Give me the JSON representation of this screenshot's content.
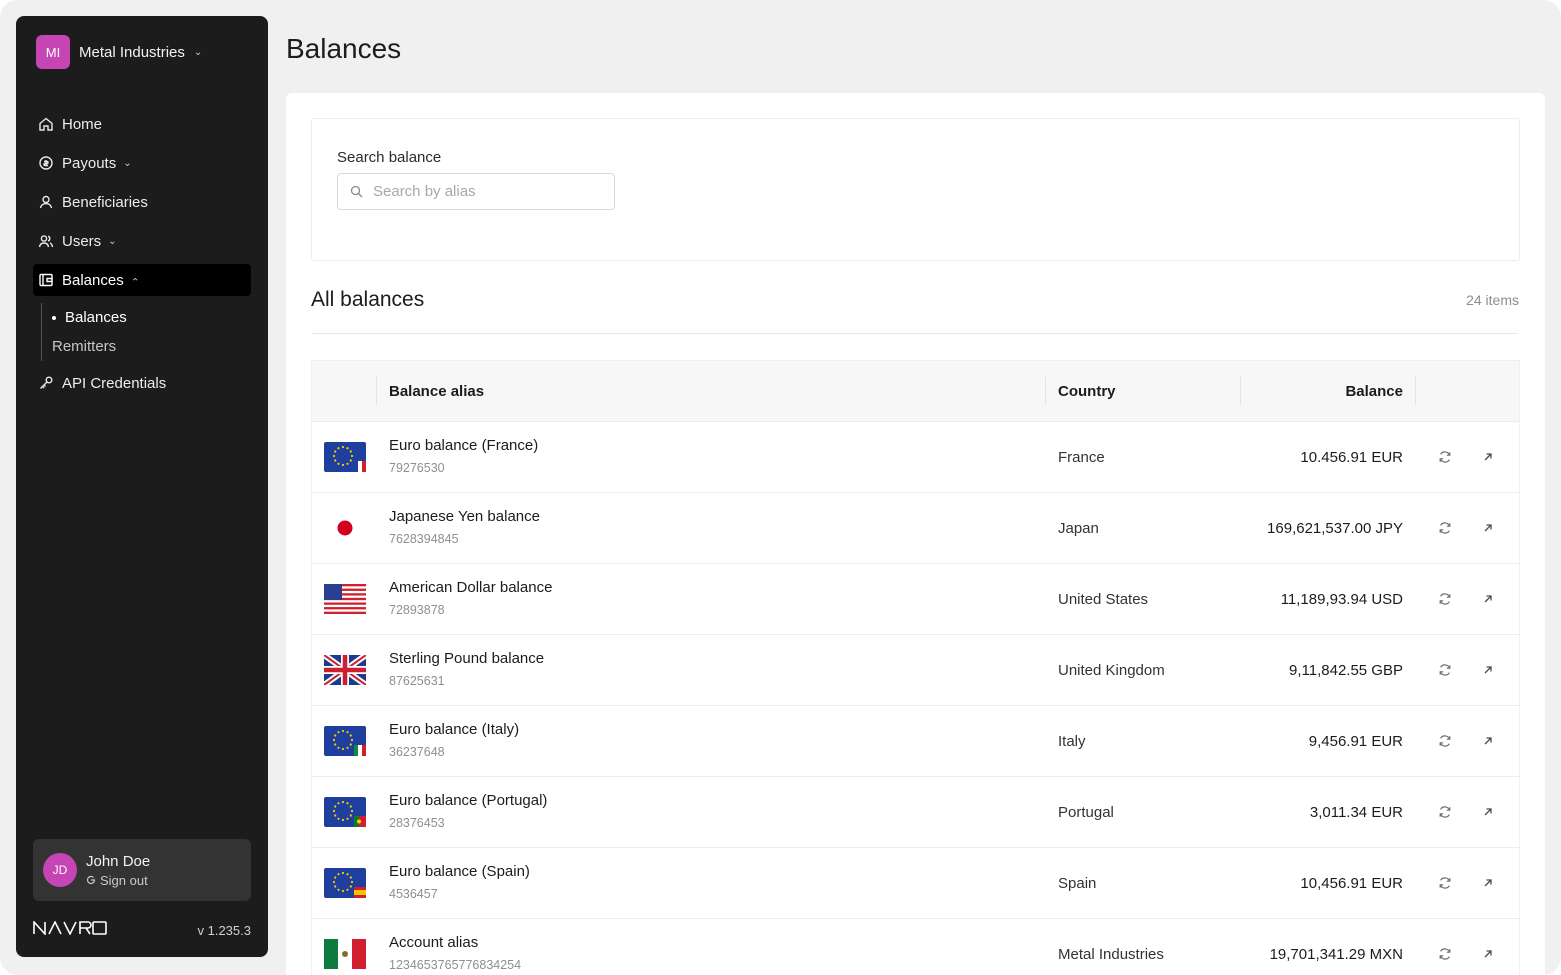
{
  "org": {
    "initials": "MI",
    "name": "Metal Industries"
  },
  "nav": {
    "home": "Home",
    "payouts": "Payouts",
    "beneficiaries": "Beneficiaries",
    "users": "Users",
    "balances": "Balances",
    "sub_balances": "Balances",
    "sub_remitters": "Remitters",
    "api": "API Credentials"
  },
  "user": {
    "initials": "JD",
    "name": "John Doe",
    "signout": "Sign out"
  },
  "brand": {
    "logo": "NAVRO",
    "version": "v 1.235.3"
  },
  "page": {
    "title": "Balances"
  },
  "search": {
    "label": "Search balance",
    "placeholder": "Search by alias",
    "value": ""
  },
  "section": {
    "title": "All balances",
    "count": "24 items"
  },
  "table": {
    "headers": {
      "alias": "Balance alias",
      "country": "Country",
      "balance": "Balance"
    },
    "rows": [
      {
        "flag": "eu-fr",
        "alias": "Euro balance (France)",
        "account": "79276530",
        "country": "France",
        "balance": "10.456.91 EUR"
      },
      {
        "flag": "jp",
        "alias": "Japanese Yen balance",
        "account": "7628394845",
        "country": "Japan",
        "balance": "169,621,537.00 JPY"
      },
      {
        "flag": "us",
        "alias": "American Dollar balance",
        "account": "72893878",
        "country": "United States",
        "balance": "11,189,93.94 USD"
      },
      {
        "flag": "gb",
        "alias": "Sterling Pound balance",
        "account": "87625631",
        "country": "United Kingdom",
        "balance": "9,11,842.55 GBP"
      },
      {
        "flag": "eu-it",
        "alias": "Euro balance (Italy)",
        "account": "36237648",
        "country": "Italy",
        "balance": "9,456.91 EUR"
      },
      {
        "flag": "eu-pt",
        "alias": "Euro balance (Portugal)",
        "account": "28376453",
        "country": "Portugal",
        "balance": "3,011.34 EUR"
      },
      {
        "flag": "eu-es",
        "alias": "Euro balance (Spain)",
        "account": "4536457",
        "country": "Spain",
        "balance": "10,456.91 EUR"
      },
      {
        "flag": "mx",
        "alias": "Account alias",
        "account": "1234653765776834254",
        "country": "Metal Industries",
        "balance": "19,701,341.29 MXN"
      }
    ]
  },
  "colors": {
    "sidebar": "#1c1c1c",
    "accent": "#c545b4",
    "background": "#f0f0f0"
  }
}
